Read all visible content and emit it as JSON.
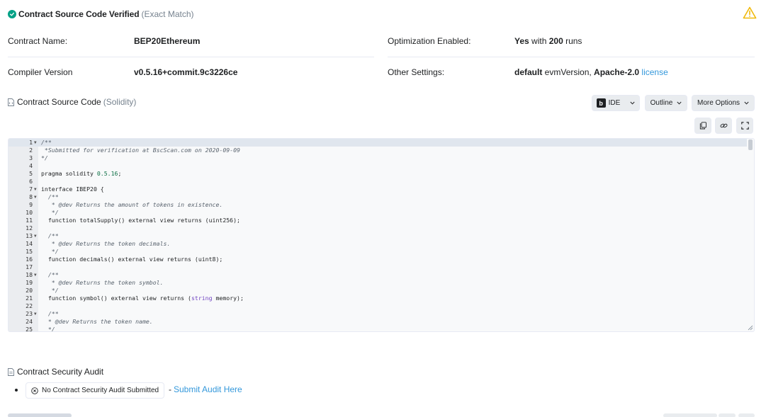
{
  "verification": {
    "title": "Contract Source Code Verified",
    "subtitle": "(Exact Match)",
    "warning_icon": "warning-triangle-icon"
  },
  "details": {
    "contract_name_label": "Contract Name:",
    "contract_name": "BEP20Ethereum",
    "optimization_label": "Optimization Enabled:",
    "optimization_yes": "Yes",
    "optimization_with": " with ",
    "optimization_runs": "200",
    "optimization_runs_suffix": " runs",
    "compiler_label": "Compiler Version",
    "compiler_version": "v0.5.16+commit.9c3226ce",
    "other_settings_label": "Other Settings:",
    "other_default": "default",
    "other_evm": " evmVersion, ",
    "other_license_name": "Apache-2.0",
    "other_license_link": "license"
  },
  "source": {
    "title": "Contract Source Code",
    "subtitle": "(Solidity)",
    "ide_button": "IDE",
    "outline_button": "Outline",
    "more_options_button": "More Options",
    "lines": [
      {
        "n": "1",
        "fold": true,
        "text": "/**",
        "type": "comment"
      },
      {
        "n": "2",
        "fold": false,
        "text": " *Submitted for verification at BscScan.com on 2020-09-09",
        "type": "comment"
      },
      {
        "n": "3",
        "fold": false,
        "text": "*/",
        "type": "comment"
      },
      {
        "n": "4",
        "fold": false,
        "text": "",
        "type": "code"
      },
      {
        "n": "5",
        "fold": false,
        "text": "pragma solidity 0.5.16;",
        "type": "pragma"
      },
      {
        "n": "6",
        "fold": false,
        "text": "",
        "type": "code"
      },
      {
        "n": "7",
        "fold": true,
        "text": "interface IBEP20 {",
        "type": "code"
      },
      {
        "n": "8",
        "fold": true,
        "text": "  /**",
        "type": "comment"
      },
      {
        "n": "9",
        "fold": false,
        "text": "   * @dev Returns the amount of tokens in existence.",
        "type": "comment"
      },
      {
        "n": "10",
        "fold": false,
        "text": "   */",
        "type": "comment"
      },
      {
        "n": "11",
        "fold": false,
        "text": "  function totalSupply() external view returns (uint256);",
        "type": "code"
      },
      {
        "n": "12",
        "fold": false,
        "text": "",
        "type": "code"
      },
      {
        "n": "13",
        "fold": true,
        "text": "  /**",
        "type": "comment"
      },
      {
        "n": "14",
        "fold": false,
        "text": "   * @dev Returns the token decimals.",
        "type": "comment"
      },
      {
        "n": "15",
        "fold": false,
        "text": "   */",
        "type": "comment"
      },
      {
        "n": "16",
        "fold": false,
        "text": "  function decimals() external view returns (uint8);",
        "type": "code"
      },
      {
        "n": "17",
        "fold": false,
        "text": "",
        "type": "code"
      },
      {
        "n": "18",
        "fold": true,
        "text": "  /**",
        "type": "comment"
      },
      {
        "n": "19",
        "fold": false,
        "text": "   * @dev Returns the token symbol.",
        "type": "comment"
      },
      {
        "n": "20",
        "fold": false,
        "text": "   */",
        "type": "comment"
      },
      {
        "n": "21",
        "fold": false,
        "text": "  function symbol() external view returns (string memory);",
        "type": "string"
      },
      {
        "n": "22",
        "fold": false,
        "text": "",
        "type": "code"
      },
      {
        "n": "23",
        "fold": true,
        "text": "  /**",
        "type": "comment"
      },
      {
        "n": "24",
        "fold": false,
        "text": "  * @dev Returns the token name.",
        "type": "comment"
      },
      {
        "n": "25",
        "fold": false,
        "text": "  */",
        "type": "comment"
      }
    ]
  },
  "audit": {
    "title": "Contract Security Audit",
    "pill": "No Contract Security Audit Submitted",
    "dash": "-",
    "link": "Submit Audit Here"
  },
  "colors": {
    "verified_green": "#00a186",
    "warning_yellow": "#f0b90b",
    "link_blue": "#3498db"
  }
}
